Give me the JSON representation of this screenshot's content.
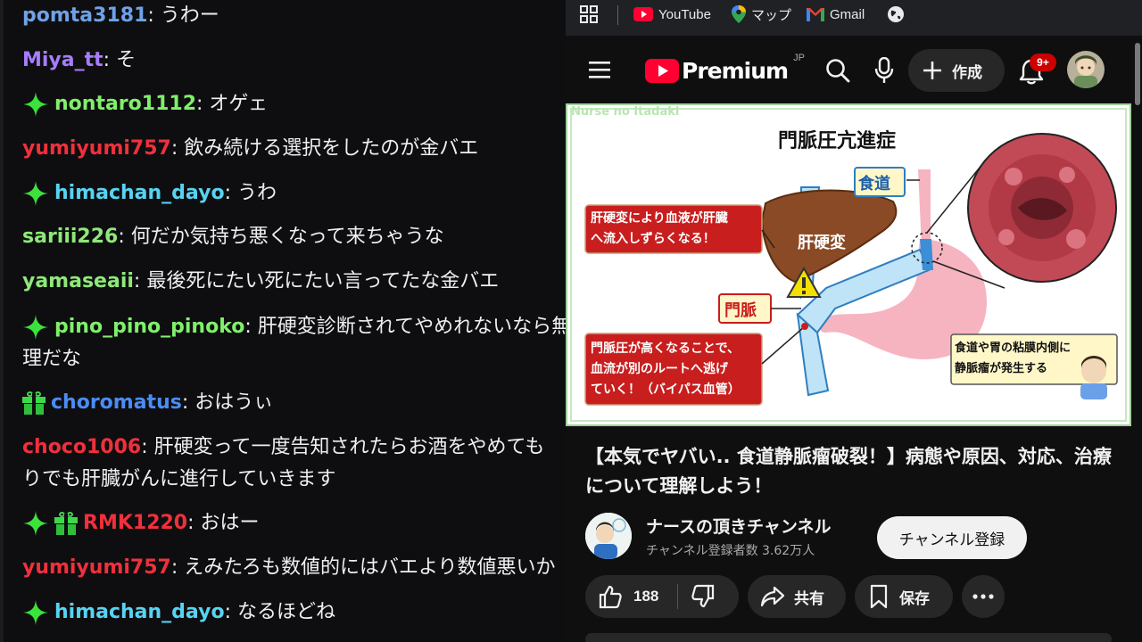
{
  "chat": {
    "messages": [
      {
        "user": "pomta3181",
        "color": "#6fa2e6",
        "text": "うわー",
        "badges": []
      },
      {
        "user": "Miya_tt",
        "color": "#a77dff",
        "text": "そ",
        "badges": []
      },
      {
        "user": "nontaro1112",
        "color": "#7ff06a",
        "text": "オゲェ",
        "badges": [
          "sparkle"
        ]
      },
      {
        "user": "yumiyumi757",
        "color": "#f0303c",
        "text": "飲み続ける選択をしたのが金バエ",
        "badges": []
      },
      {
        "user": "himachan_dayo",
        "color": "#58d3f2",
        "text": "うわ",
        "badges": [
          "sparkle"
        ]
      },
      {
        "user": "sariii226",
        "color": "#8fe87a",
        "text": "何だか気持ち悪くなって来ちゃうな",
        "badges": []
      },
      {
        "user": "yamaseaii",
        "color": "#8fe87a",
        "text": "最後死にたい死にたい言ってたな金バエ",
        "badges": []
      },
      {
        "user": "pino_pino_pinoko",
        "color": "#7ff06a",
        "text": "肝硬変診断されてやめれないなら無",
        "cont": "理だな",
        "badges": [
          "sparkle"
        ]
      },
      {
        "user": "choromatus",
        "color": "#4b8cf5",
        "text": "おはうぃ",
        "badges": [
          "gift"
        ]
      },
      {
        "user": "choco1006",
        "color": "#f0303c",
        "text": "肝硬変って一度告知されたらお酒をやめても",
        "cont": "りでも肝臓がんに進行していきます",
        "badges": []
      },
      {
        "user": "RMK1220",
        "color": "#f0303c",
        "text": "おはー",
        "badges": [
          "sparkle",
          "gift"
        ]
      },
      {
        "user": "yumiyumi757",
        "color": "#f0303c",
        "text": "えみたろも数値的にはバエより数値悪いか",
        "badges": []
      },
      {
        "user": "himachan_dayo",
        "color": "#58d3f2",
        "text": "なるほどね",
        "badges": [
          "sparkle"
        ]
      }
    ]
  },
  "bookmarks": {
    "apps_icon": "apps-grid-icon",
    "youtube": "YouTube",
    "maps": "マップ",
    "gmail": "Gmail"
  },
  "header": {
    "logo_text": "Premium",
    "logo_region": "JP",
    "create_label": "作成",
    "notif_count": "9+"
  },
  "thumbnail": {
    "watermark": "Nurse no Itadaki",
    "heading": "門脈圧亢進症",
    "label_esophagus": "食道",
    "label_liver": "肝硬変",
    "label_portal_vein": "門脈",
    "callout_top": [
      "肝硬変により血液が肝臓",
      "へ流入しずらくなる！"
    ],
    "callout_bottom": [
      "門脈圧が高くなることで、",
      "血流が別のルートへ逃げ",
      "ていく！（バイパス血管）"
    ],
    "callout_right": [
      "食道や胃の粘膜内側に",
      "静脈瘤が発生する"
    ]
  },
  "video": {
    "title": "【本気でヤバい.. 食道静脈瘤破裂！】病態や原因、対応、治療について理解しよう！",
    "channel_name": "ナースの頂きチャンネル",
    "subscribers": "チャンネル登録者数 3.62万人",
    "subscribe_label": "チャンネル登録",
    "likes": "188",
    "share_label": "共有",
    "save_label": "保存"
  },
  "colors": {
    "chat_bg": "#0e0e10",
    "yt_red": "#ff0033",
    "sparkle": "#3be23b",
    "gift": "#3dd94a"
  }
}
